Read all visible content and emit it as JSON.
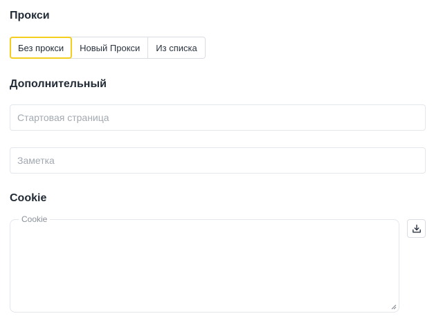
{
  "proxy": {
    "title": "Прокси",
    "options": [
      {
        "label": "Без прокси",
        "selected": true
      },
      {
        "label": "Новый Прокси",
        "selected": false
      },
      {
        "label": "Из списка",
        "selected": false
      }
    ],
    "accent_color": "#f5cd1c"
  },
  "extra": {
    "title": "Дополнительный",
    "start_page": {
      "placeholder": "Стартовая страница",
      "value": ""
    },
    "note": {
      "placeholder": "Заметка",
      "value": ""
    }
  },
  "cookie": {
    "title": "Cookie",
    "field_label": "Cookie",
    "value": "",
    "import_icon": "download-tray-icon"
  }
}
